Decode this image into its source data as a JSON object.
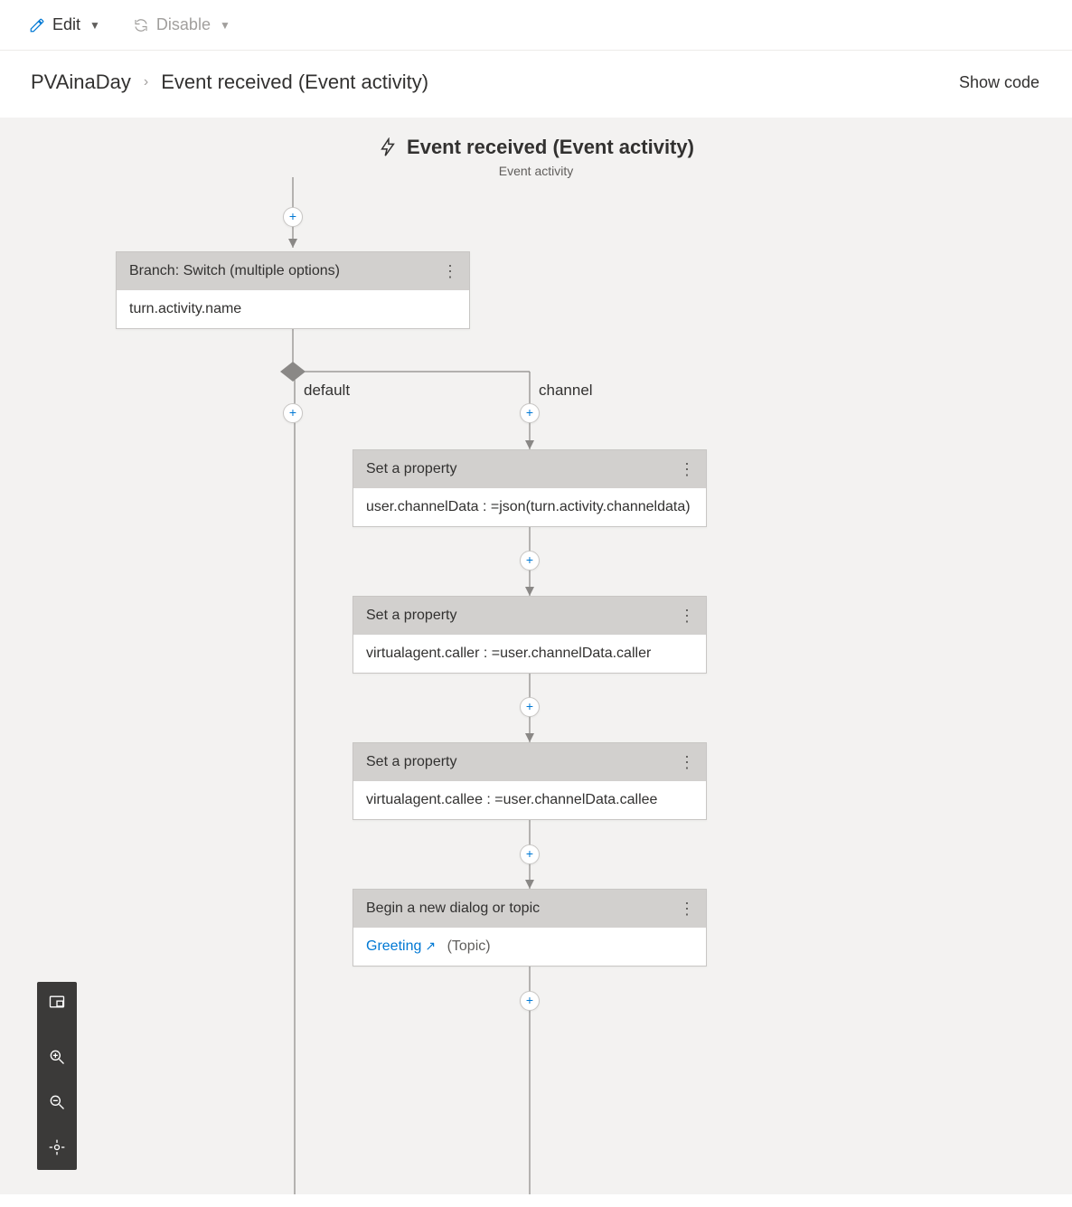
{
  "toolbar": {
    "edit_label": "Edit",
    "disable_label": "Disable"
  },
  "breadcrumb": {
    "root": "PVAinaDay",
    "leaf": "Event received (Event activity)"
  },
  "show_code_label": "Show code",
  "trigger": {
    "title": "Event received (Event activity)",
    "subtitle": "Event activity"
  },
  "branch_node": {
    "title": "Branch: Switch (multiple options)",
    "condition": "turn.activity.name"
  },
  "branches": {
    "default_label": "default",
    "channel_label": "channel"
  },
  "channel_steps": [
    {
      "title": "Set a property",
      "body": "user.channelData : =json(turn.activity.channeldata)"
    },
    {
      "title": "Set a property",
      "body": "virtualagent.caller : =user.channelData.caller"
    },
    {
      "title": "Set a property",
      "body": "virtualagent.callee : =user.channelData.callee"
    },
    {
      "title": "Begin a new dialog or topic",
      "link": "Greeting",
      "annot": "(Topic)"
    }
  ]
}
